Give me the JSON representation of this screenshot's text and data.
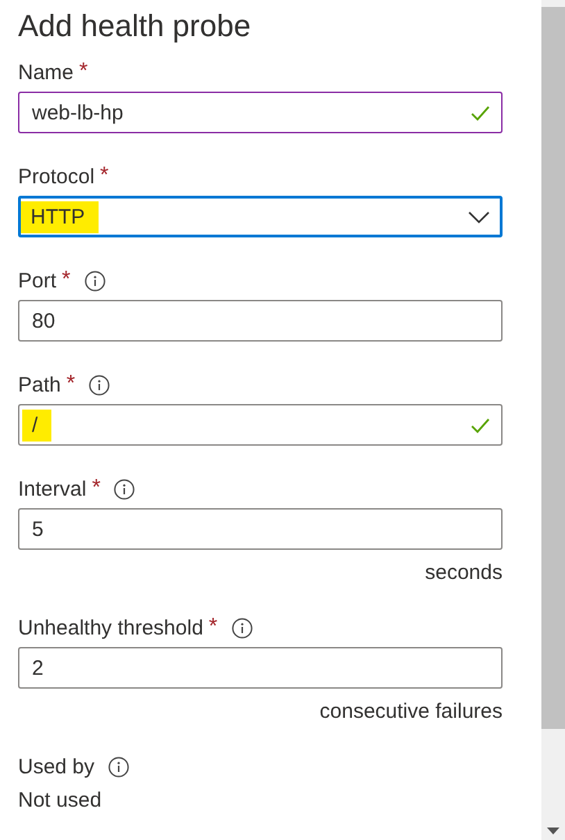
{
  "title": "Add health probe",
  "fields": [
    {
      "kind": "text",
      "label": "Name",
      "required_mark": "*",
      "info": false,
      "value": "web-lb-hp",
      "valid": true,
      "highlighted": false,
      "hovered": true,
      "focused": false
    },
    {
      "kind": "select",
      "label": "Protocol",
      "required_mark": "*",
      "info": false,
      "value": "HTTP",
      "valid": false,
      "highlighted": true,
      "hovered": false,
      "focused": true
    },
    {
      "kind": "text",
      "label": "Port",
      "required_mark": "*",
      "info": true,
      "value": "80",
      "valid": false,
      "highlighted": false,
      "hovered": false,
      "focused": false
    },
    {
      "kind": "text",
      "label": "Path",
      "required_mark": "*",
      "info": true,
      "value": "/",
      "valid": true,
      "highlighted": true,
      "hovered": false,
      "focused": false
    },
    {
      "kind": "text",
      "label": "Interval",
      "required_mark": "*",
      "info": true,
      "value": "5",
      "valid": false,
      "highlighted": false,
      "hovered": false,
      "focused": false,
      "unit": "seconds"
    },
    {
      "kind": "text",
      "label": "Unhealthy threshold",
      "required_mark": "*",
      "info": true,
      "value": "2",
      "valid": false,
      "highlighted": false,
      "hovered": false,
      "focused": false,
      "unit": "consecutive failures"
    }
  ],
  "used_by": {
    "label": "Used by",
    "info": true,
    "value": "Not used"
  }
}
